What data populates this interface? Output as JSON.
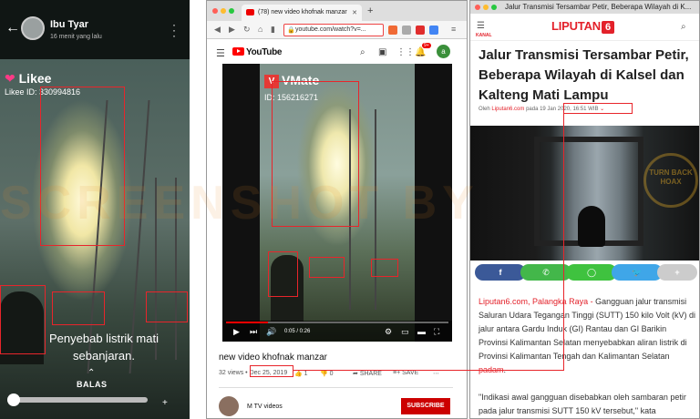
{
  "left": {
    "username": "Ibu Tyar",
    "time": "16 menit yang lalu",
    "app_logo": "Likee",
    "likee_id": "Likee ID: 330994816",
    "caption_line1": "Penyebab listrik mati",
    "caption_line2": "sebanjaran.",
    "reply": "BALAS"
  },
  "middle": {
    "tab_title": "(78) new video khofnak manzar",
    "url": "youtube.com/watch?v=...",
    "yt_brand": "YouTube",
    "notif_count": "9+",
    "avatar_letter": "a",
    "vmate_text": "VMate",
    "video_id": "ID: 156216271",
    "time_display": "0:05 / 0:26",
    "video_title": "new video khofnak manzar",
    "views": "32 views",
    "date": "Dec 25, 2019",
    "likes": "1",
    "dislikes": "0",
    "share": "SHARE",
    "save": "SAVE",
    "channel": "M TV videos",
    "subscribe": "SUBSCRIBE"
  },
  "right": {
    "window_title": "Jalur Transmisi Tersambar Petir, Beberapa Wilayah di K...",
    "kanal": "KANAL",
    "logo": "LIPUTAN",
    "logo_six": "6",
    "headline": "Jalur Transmisi Tersambar Petir, Beberapa Wilayah di Kalsel dan Kalteng Mati Lampu",
    "by_prefix": "Oleh",
    "by_source": "Liputan6.com",
    "by_on": "pada",
    "by_date": "19 Jan 2020, 16:51 WIB",
    "photo_watermark": "TURN BACK HOAX",
    "p1_source": "Liputan6.com, Palangka Raya -",
    "p1_text": " Gangguan jalur transmisi Saluran Udara Tegangan Tinggi (SUTT) 150 kilo Volt (kV) di jalur antara Gardu Induk (GI) Rantau dan GI Barikin Provinsi Kalimantan Selatan menyebabkan aliran listrik di Provinsi Kalimantan Tengah dan Kalimantan Selatan ",
    "p1_link": "padam",
    "p1_end": ".",
    "p2_text": "\"Indikasi awal gangguan disebabkan oleh sambaran petir pada jalur transmisi SUTT 150 kV tersebut,\" kata"
  },
  "watermark": "SCREENSHOT BY",
  "colors": {
    "highlight": "#e8252b",
    "liputan_red": "#e3212a",
    "youtube_red": "#ff0000",
    "facebook": "#3b5998",
    "whatsapp": "#43b74a",
    "line": "#3fc23f",
    "twitter": "#3fa6e8",
    "plus": "#cccccc"
  }
}
